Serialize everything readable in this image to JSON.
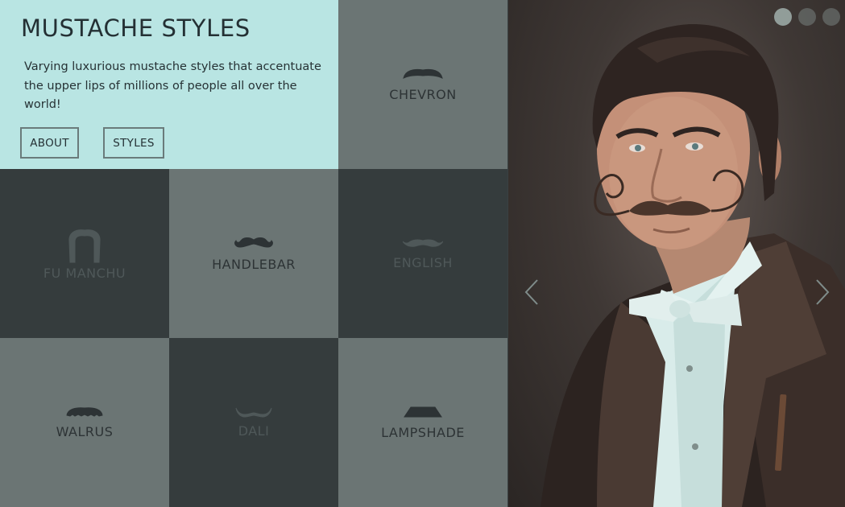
{
  "intro": {
    "title": "MUSTACHE STYLES",
    "description": "Varying luxurious mustache styles that accentuate the upper lips of millions of people all over the world!",
    "about_label": "ABOUT",
    "styles_label": "STYLES"
  },
  "tiles": [
    {
      "label": "CHEVRON",
      "icon": "chevron-mustache-icon"
    },
    {
      "label": "FU MANCHU",
      "icon": "fu-manchu-mustache-icon"
    },
    {
      "label": "HANDLEBAR",
      "icon": "handlebar-mustache-icon"
    },
    {
      "label": "ENGLISH",
      "icon": "english-mustache-icon"
    },
    {
      "label": "WALRUS",
      "icon": "walrus-mustache-icon"
    },
    {
      "label": "DALI",
      "icon": "dali-mustache-icon"
    },
    {
      "label": "LAMPSHADE",
      "icon": "lampshade-mustache-icon"
    }
  ],
  "slider": {
    "dot_count": 3,
    "active_dot": 1,
    "prev_icon": "chevron-left-icon",
    "next_icon": "chevron-right-icon"
  },
  "colors": {
    "intro_bg": "#b9e5e3",
    "tile_dark": "#353c3d",
    "tile_mid": "#6b7574"
  }
}
